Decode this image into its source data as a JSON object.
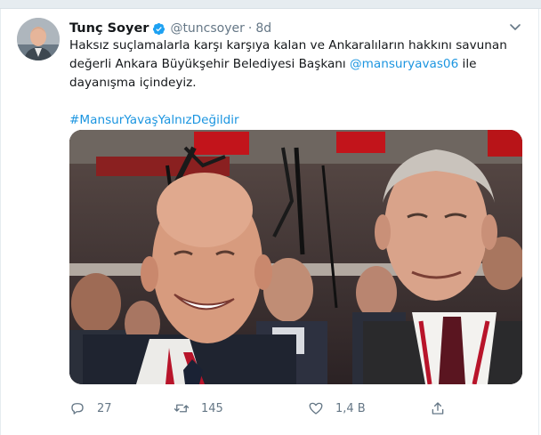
{
  "tweet": {
    "author_name": "Tunç Soyer",
    "author_handle": "@tuncsoyer",
    "separator": "·",
    "time": "8d",
    "text_line1": "Haksız suçlamalarla karşı karşıya kalan ve Ankaralıların hakkını savunan",
    "text_line2": "değerli Ankara Büyükşehir Belediyesi Başkanı ",
    "mention": "@mansuryavas06",
    "text_line2_end": " ile",
    "text_line3": "dayanışma içindeyiz.",
    "hashtag": "#MansurYavaşYalnızDeğildir"
  },
  "actions": {
    "reply_count": "27",
    "retweet_count": "145",
    "like_count": "1,4 B"
  },
  "colors": {
    "link": "#1b95e0",
    "verified": "#1da1f2",
    "secondary_text": "#657786"
  },
  "icons": [
    "verified-icon",
    "chevron-down-icon",
    "reply-icon",
    "retweet-icon",
    "like-icon",
    "share-icon"
  ]
}
